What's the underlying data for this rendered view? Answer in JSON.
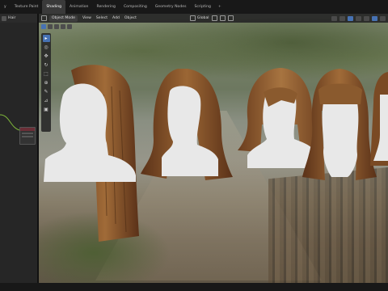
{
  "workspace_tabs": [
    {
      "label": "y",
      "active": false
    },
    {
      "label": "Texture Paint",
      "active": false
    },
    {
      "label": "Shading",
      "active": true
    },
    {
      "label": "Animation",
      "active": false
    },
    {
      "label": "Rendering",
      "active": false
    },
    {
      "label": "Compositing",
      "active": false
    },
    {
      "label": "Geometry Nodes",
      "active": false
    },
    {
      "label": "Scripting",
      "active": false
    }
  ],
  "add_tab_label": "+",
  "left_panel": {
    "object_name": "Hair"
  },
  "viewport_header": {
    "mode": "Object Mode",
    "menus": [
      "View",
      "Select",
      "Add",
      "Object"
    ],
    "orientation": "Global"
  },
  "toolbar_tools": [
    {
      "icon": "cursor-select-icon",
      "glyph": "▸",
      "active": true
    },
    {
      "icon": "3d-cursor-icon",
      "glyph": "◎",
      "active": false
    },
    {
      "icon": "move-icon",
      "glyph": "✥",
      "active": false
    },
    {
      "icon": "rotate-icon",
      "glyph": "↻",
      "active": false
    },
    {
      "icon": "scale-icon",
      "glyph": "⬚",
      "active": false
    },
    {
      "icon": "transform-icon",
      "glyph": "⊕",
      "active": false
    },
    {
      "icon": "annotate-icon",
      "glyph": "✎",
      "active": false
    },
    {
      "icon": "measure-icon",
      "glyph": "⊿",
      "active": false
    },
    {
      "icon": "add-cube-icon",
      "glyph": "▣",
      "active": false
    }
  ],
  "colors": {
    "active_tab": "#3a3a3a",
    "accent_blue": "#4772b3",
    "hair_dark": "#5a3118",
    "hair_mid": "#8a5a2e",
    "hair_light": "#b07a44",
    "bust": "#e8e8e8"
  }
}
